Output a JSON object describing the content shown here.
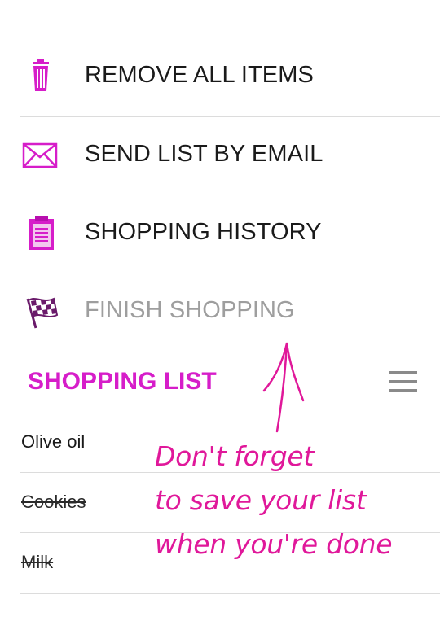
{
  "menu": {
    "items": [
      {
        "label": "REMOVE ALL ITEMS",
        "icon": "trash-icon"
      },
      {
        "label": "SEND LIST BY EMAIL",
        "icon": "mail-icon"
      },
      {
        "label": "SHOPPING HISTORY",
        "icon": "clipboard-icon"
      },
      {
        "label": "FINISH SHOPPING",
        "icon": "checkered-flag-icon",
        "disabled": true
      }
    ]
  },
  "list": {
    "title": "SHOPPING LIST",
    "items": [
      {
        "name": "Olive oil",
        "checked": false
      },
      {
        "name": "Cookies",
        "checked": true
      },
      {
        "name": "Milk",
        "checked": true
      }
    ]
  },
  "annotation": {
    "lines": [
      "Don't forget",
      "to save your list",
      "when you're done"
    ]
  },
  "colors": {
    "accent": "#d61dc9",
    "annotation": "#e0189a",
    "disabled_text": "#9e9e9e"
  }
}
